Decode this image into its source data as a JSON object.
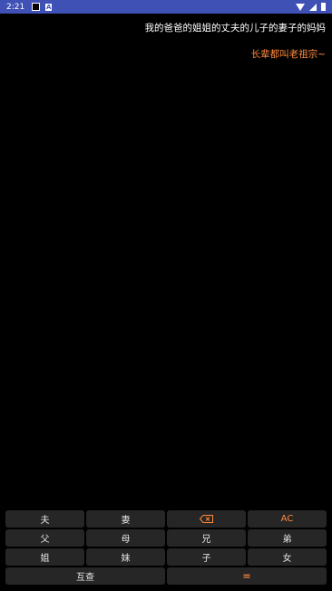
{
  "status_bar": {
    "time": "2:21",
    "icons": [
      "notification-square-icon",
      "app-a-icon",
      "wifi-icon",
      "signal-icon",
      "battery-icon"
    ]
  },
  "display": {
    "expression": "我的爸爸的姐姐的丈夫的儿子的妻子的妈妈",
    "result": "长辈都叫老祖宗~"
  },
  "keypad": {
    "row1": {
      "husband": "夫",
      "wife": "妻",
      "backspace_icon": "backspace-icon",
      "clear": "AC"
    },
    "row2": {
      "father": "父",
      "mother": "母",
      "elder_brother": "兄",
      "younger_brother": "弟"
    },
    "row3": {
      "elder_sister": "姐",
      "younger_sister": "妹",
      "son": "子",
      "daughter": "女"
    },
    "row4": {
      "mutual": "互查",
      "equals": "="
    }
  },
  "colors": {
    "background": "#000000",
    "status_bar": "#3f51b5",
    "accent": "#ff8a3d",
    "key_bg": "#262626",
    "text": "#ffffff"
  }
}
